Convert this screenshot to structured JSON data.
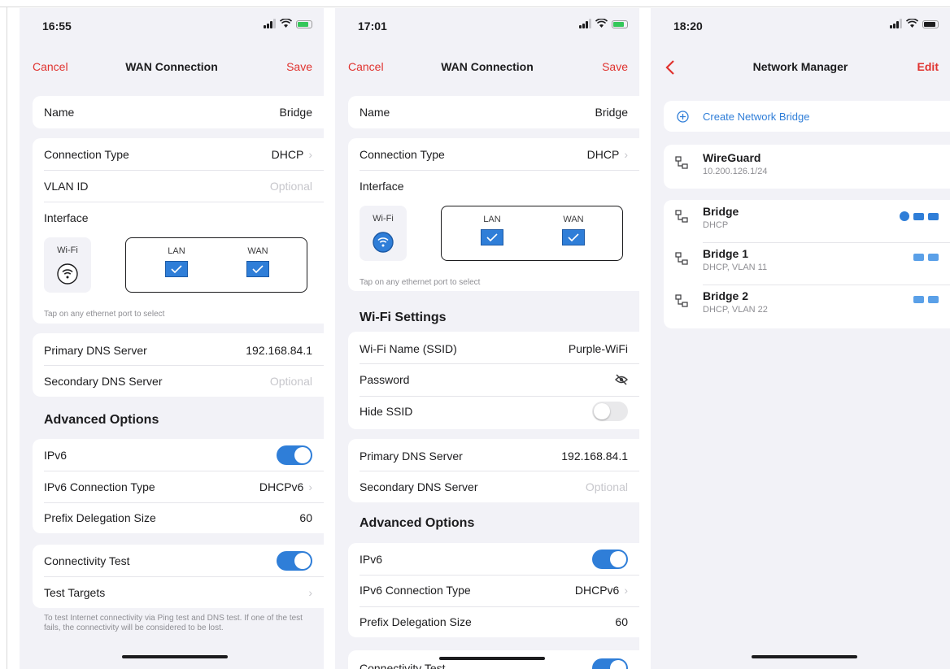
{
  "colors": {
    "accent": "#e0332f",
    "blue": "#2f7ed8",
    "bg": "#f2f2f7"
  },
  "p1": {
    "time": "16:55",
    "nav": {
      "cancel": "Cancel",
      "title": "WAN Connection",
      "save": "Save"
    },
    "name": {
      "label": "Name",
      "value": "Bridge"
    },
    "conn_type": {
      "label": "Connection Type",
      "value": "DHCP"
    },
    "vlan": {
      "label": "VLAN ID",
      "placeholder": "Optional"
    },
    "interface": {
      "label": "Interface",
      "wifi": "Wi-Fi",
      "lan": "LAN",
      "wan": "WAN",
      "hint": "Tap on any ethernet port to select"
    },
    "dns1": {
      "label": "Primary DNS Server",
      "value": "192.168.84.1"
    },
    "dns2": {
      "label": "Secondary DNS Server",
      "placeholder": "Optional"
    },
    "advanced": "Advanced Options",
    "ipv6": {
      "label": "IPv6"
    },
    "ipv6_type": {
      "label": "IPv6 Connection Type",
      "value": "DHCPv6"
    },
    "prefix": {
      "label": "Prefix Delegation Size",
      "value": "60"
    },
    "conn_test": {
      "label": "Connectivity Test"
    },
    "targets": {
      "label": "Test Targets"
    },
    "footer": "To test Internet connectivity via Ping test and DNS test. If one of the test fails, the connectivity will be considered to be lost."
  },
  "p2": {
    "time": "17:01",
    "nav": {
      "cancel": "Cancel",
      "title": "WAN Connection",
      "save": "Save"
    },
    "name": {
      "label": "Name",
      "value": "Bridge"
    },
    "conn_type": {
      "label": "Connection Type",
      "value": "DHCP"
    },
    "interface": {
      "label": "Interface",
      "wifi": "Wi-Fi",
      "lan": "LAN",
      "wan": "WAN",
      "hint": "Tap on any ethernet port to select"
    },
    "wifi_settings": "Wi-Fi Settings",
    "ssid": {
      "label": "Wi-Fi Name (SSID)",
      "value": "Purple-WiFi"
    },
    "password": {
      "label": "Password"
    },
    "hide_ssid": {
      "label": "Hide SSID"
    },
    "dns1": {
      "label": "Primary DNS Server",
      "value": "192.168.84.1"
    },
    "dns2": {
      "label": "Secondary DNS Server",
      "placeholder": "Optional"
    },
    "advanced": "Advanced Options",
    "ipv6": {
      "label": "IPv6"
    },
    "ipv6_type": {
      "label": "IPv6 Connection Type",
      "value": "DHCPv6"
    },
    "prefix": {
      "label": "Prefix Delegation Size",
      "value": "60"
    },
    "conn_test": {
      "label": "Connectivity Test"
    }
  },
  "p3": {
    "time": "18:20",
    "nav": {
      "title": "Network Manager",
      "edit": "Edit"
    },
    "create": "Create Network Bridge",
    "networks": [
      {
        "title": "WireGuard",
        "sub": "10.200.126.1/24"
      },
      {
        "title": "Bridge",
        "sub": "DHCP"
      },
      {
        "title": "Bridge 1",
        "sub": "DHCP, VLAN 11"
      },
      {
        "title": "Bridge 2",
        "sub": "DHCP, VLAN 22"
      }
    ]
  }
}
